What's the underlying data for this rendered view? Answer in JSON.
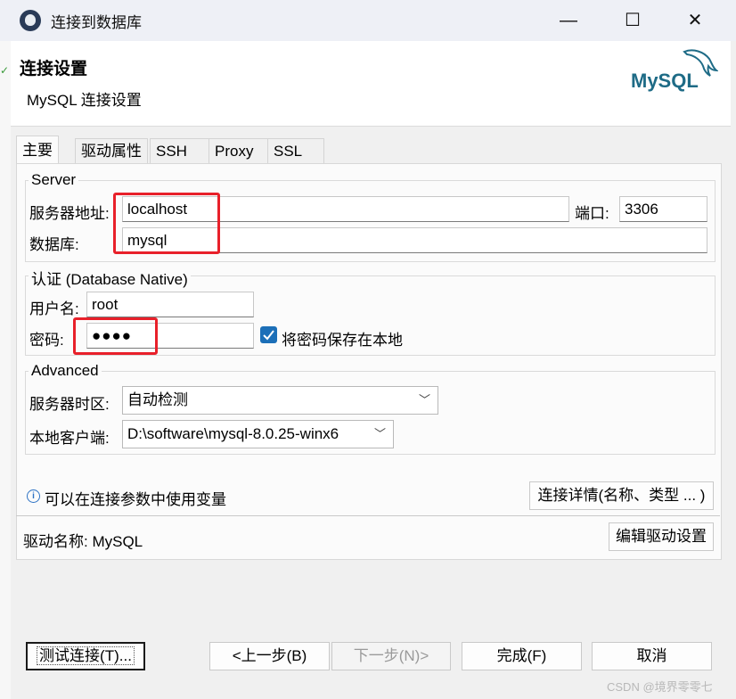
{
  "window": {
    "title": "连接到数据库",
    "minimize": "—",
    "maximize": "☐",
    "close": "✕"
  },
  "header": {
    "title": "连接设置",
    "subtitle": "MySQL 连接设置",
    "logo_text": "MySQL"
  },
  "tabs": [
    {
      "label": "主要",
      "active": true
    },
    {
      "label": "驱动属性"
    },
    {
      "label": "SSH"
    },
    {
      "label": "Proxy"
    },
    {
      "label": "SSL"
    }
  ],
  "server": {
    "group_title": "Server",
    "host_label": "服务器地址:",
    "host_value": "localhost",
    "port_label": "端口:",
    "port_value": "3306",
    "db_label": "数据库:",
    "db_value": "mysql"
  },
  "auth": {
    "group_title": "认证 (Database Native)",
    "user_label": "用户名:",
    "user_value": "root",
    "password_label": "密码:",
    "password_value": "●●●●",
    "save_password_label": "将密码保存在本地",
    "save_password_checked": true
  },
  "advanced": {
    "group_title": "Advanced",
    "timezone_label": "服务器时区:",
    "timezone_value": "自动检测",
    "client_label": "本地客户端:",
    "client_value": "D:\\software\\mysql-8.0.25-winx6"
  },
  "info": {
    "variables_text": "可以在连接参数中使用变量",
    "details_button": "连接详情(名称、类型 ... )"
  },
  "driver": {
    "label": "驱动名称: MySQL",
    "edit_button": "编辑驱动设置"
  },
  "footer": {
    "test_button": "测试连接(T)...",
    "back_button": "<上一步(B)",
    "next_button": "下一步(N)>",
    "finish_button": "完成(F)",
    "cancel_button": "取消"
  },
  "watermark": "CSDN @境界零零七",
  "colors": {
    "accent": "#1c6fb8",
    "highlight": "#e8202a",
    "logo_blue": "#1e6b86",
    "logo_orange": "#e48e00"
  }
}
